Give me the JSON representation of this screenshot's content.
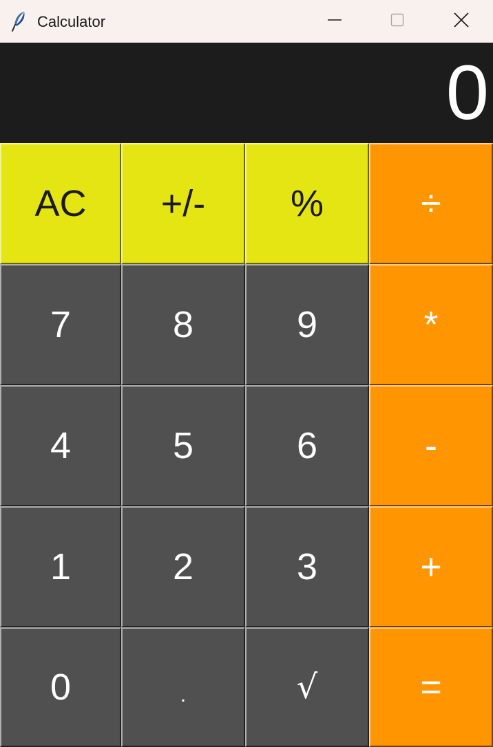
{
  "window": {
    "title": "Calculator",
    "icon": "feather-icon",
    "controls": [
      "minimize-icon",
      "maximize-icon",
      "close-icon"
    ]
  },
  "display": {
    "value": "0"
  },
  "keys": {
    "clear": "AC",
    "negate": "+/-",
    "percent": "%",
    "divide": "÷",
    "seven": "7",
    "eight": "8",
    "nine": "9",
    "multiply": "*",
    "four": "4",
    "five": "5",
    "six": "6",
    "subtract": "-",
    "one": "1",
    "two": "2",
    "three": "3",
    "add": "+",
    "zero": "0",
    "decimal": ".",
    "sqrt": "√",
    "equals": "="
  },
  "colors": {
    "titlebar": "#f8f1ee",
    "display_bg": "#1c1c1c",
    "function_keys": "#e6e514",
    "number_keys": "#505050",
    "operator_keys": "#ff9500",
    "text_light": "#ffffff",
    "text_dark": "#1a1a1a"
  }
}
